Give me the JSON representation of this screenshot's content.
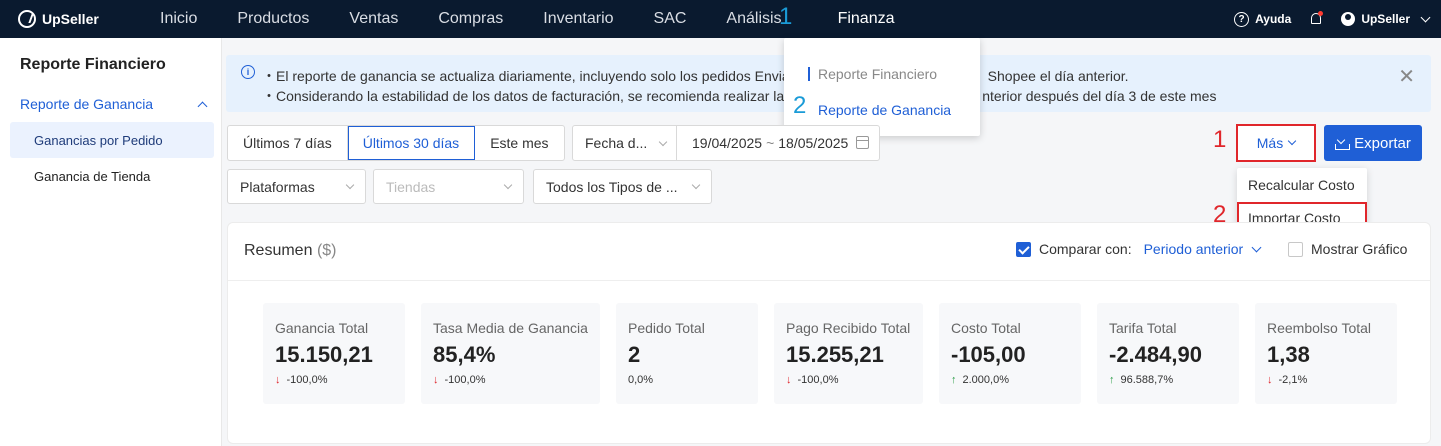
{
  "brand": "UpSeller",
  "nav": {
    "items": [
      "Inicio",
      "Productos",
      "Ventas",
      "Compras",
      "Inventario",
      "SAC",
      "Análisis"
    ],
    "active": "Finanza",
    "step_marker": "1",
    "help": "Ayuda",
    "user": "UpSeller"
  },
  "finanza_menu": {
    "items": [
      "Reporte Financiero",
      "Reporte de Ganancia"
    ],
    "step_marker": "2"
  },
  "sidebar": {
    "title": "Reporte Financiero",
    "group": "Reporte de Ganancia",
    "items": [
      "Ganancias por Pedido",
      "Ganancia de Tienda"
    ]
  },
  "banner": {
    "line1": "・El reporte de ganancia se actualiza diariamente, incluyendo solo los pedidos Envia",
    "line1_tail": "Shopee el día anterior.",
    "line2": "・Considerando la estabilidad de los datos de facturación, se recomienda realizar la",
    "line2_tail": "nterior después del día 3 de este mes"
  },
  "filters": {
    "ranges": [
      "Últimos 7 días",
      "Últimos 30 días",
      "Este mes"
    ],
    "active_range": 1,
    "date_type": "Fecha d...",
    "date_start": "19/04/2025",
    "date_sep": "~",
    "date_end": "18/05/2025",
    "platform": "Plataformas",
    "stores_placeholder": "Tiendas",
    "types": "Todos los Tipos de ..."
  },
  "actions": {
    "more": "Más",
    "more_marker": "1",
    "export": "Exportar",
    "menu": [
      "Recalcular Costo",
      "Importar Costo"
    ],
    "import_marker": "2"
  },
  "summary": {
    "title": "Resumen",
    "unit": "($)",
    "compare_label": "Comparar con:",
    "compare_checked": true,
    "compare_period": "Periodo anterior",
    "show_chart_label": "Mostrar Gráfico",
    "show_chart_checked": false,
    "metrics": [
      {
        "label": "Ganancia Total",
        "value": "15.150,21",
        "trend": "down",
        "delta": "-100,0%"
      },
      {
        "label": "Tasa Media de Ganancia",
        "value": "85,4%",
        "trend": "down",
        "delta": "-100,0%"
      },
      {
        "label": "Pedido Total",
        "value": "2",
        "trend": "none",
        "delta": "0,0%"
      },
      {
        "label": "Pago Recibido Total",
        "value": "15.255,21",
        "trend": "down",
        "delta": "-100,0%"
      },
      {
        "label": "Costo Total",
        "value": "-105,00",
        "trend": "up",
        "delta": "2.000,0%"
      },
      {
        "label": "Tarifa Total",
        "value": "-2.484,90",
        "trend": "up",
        "delta": "96.588,7%"
      },
      {
        "label": "Reembolso Total",
        "value": "1,38",
        "trend": "down",
        "delta": "-2,1%"
      }
    ]
  },
  "colors": {
    "nav_bg": "#0a1a2f",
    "accent": "#1f5fd6",
    "highlight": "#e0262b",
    "marker_blue": "#1a9bd7"
  }
}
